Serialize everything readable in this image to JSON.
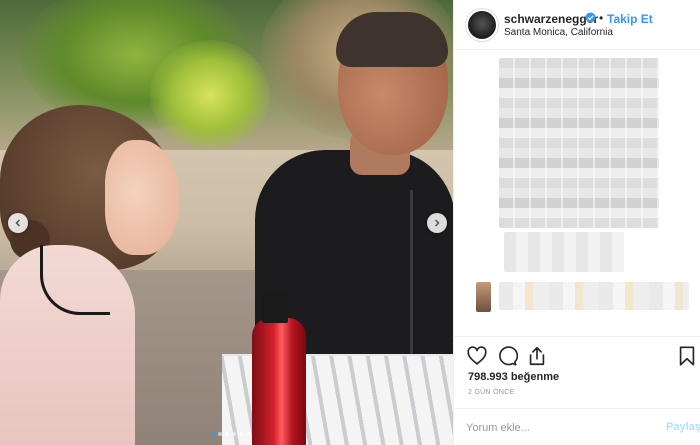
{
  "post": {
    "username": "schwarzenegger",
    "separator": "•",
    "follow_label": "Takip Et",
    "location": "Santa Monica, California",
    "likes_count": "798.993",
    "likes_label": "beğenme",
    "time_ago": "2 GÜN ÖNCE",
    "caption_visible": false
  },
  "comment": {
    "placeholder": "Yorum ekle...",
    "post_label": "Paylaş"
  },
  "carousel": {
    "total_slides": 6,
    "active_index": 0
  },
  "icons": {
    "verified": "verified-badge-icon",
    "like": "heart-icon",
    "comment": "comment-bubble-icon",
    "share": "share-icon",
    "save": "bookmark-icon",
    "prev": "chevron-left-icon",
    "next": "chevron-right-icon"
  },
  "colors": {
    "accent": "#3897f0",
    "text": "#262626",
    "muted": "#999999",
    "post_disabled": "#b2dffc",
    "border": "#efefef"
  }
}
